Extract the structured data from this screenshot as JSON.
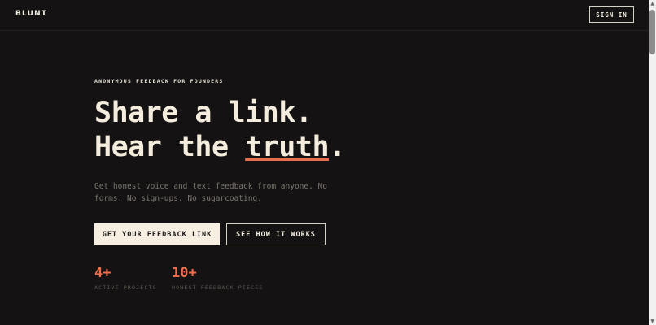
{
  "header": {
    "logo": "BLUNT",
    "sign_in_label": "SIGN IN"
  },
  "hero": {
    "eyebrow": "ANONYMOUS FEEDBACK FOR FOUNDERS",
    "headline_line1": "Share a link.",
    "headline_line2_prefix": "Hear the ",
    "headline_line2_underlined": "truth",
    "headline_line2_suffix": ".",
    "subtext": "Get honest voice and text feedback from anyone. No forms. No sign-ups. No sugarcoating.",
    "primary_cta": "GET YOUR FEEDBACK LINK",
    "secondary_cta": "SEE HOW IT WORKS"
  },
  "stats": [
    {
      "value": "4+",
      "label": "ACTIVE PROJECTS"
    },
    {
      "value": "10+",
      "label": "HONEST FEEDBACK PIECES"
    }
  ],
  "scrollbar": {
    "up_icon": "▲",
    "down_icon": "▼"
  },
  "colors": {
    "background": "#141212",
    "text": "#f4ecdc",
    "accent": "#ee6f4b",
    "muted": "#7d7770"
  }
}
